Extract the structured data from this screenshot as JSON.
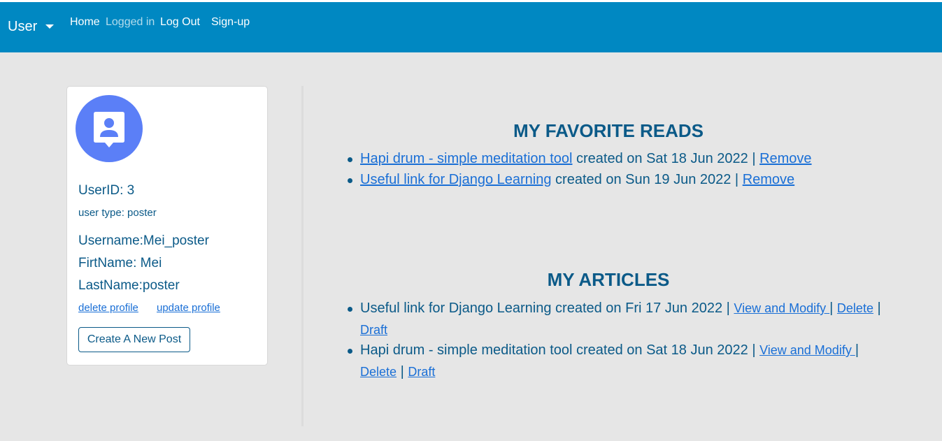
{
  "navbar": {
    "brand": "User",
    "links": {
      "home": "Home",
      "status": "Logged in",
      "logout": "Log Out",
      "signup": "Sign-up"
    }
  },
  "profile": {
    "user_id": "UserID: 3",
    "user_type": "user type: poster",
    "username": "Username:Mei_poster",
    "firstname": "FirtName: Mei",
    "lastname": "LastName:poster",
    "delete_link": "delete profile",
    "update_link": "update profile",
    "new_post_button": "Create A New Post"
  },
  "favorites": {
    "title": "MY FAVORITE READS",
    "items": [
      {
        "title": "Hapi drum - simple meditation tool",
        "meta": " created on Sat 18 Jun 2022 | ",
        "action": "Remove"
      },
      {
        "title": "Useful link for Django Learning",
        "meta": " created on Sun 19 Jun 2022 | ",
        "action": "Remove"
      }
    ]
  },
  "articles": {
    "title": "MY ARTICLES",
    "items": [
      {
        "text": "Useful link for Django Learning created on Fri 17 Jun 2022 | ",
        "view": "View and Modify ",
        "delete": "Delete",
        "draft": "Draft"
      },
      {
        "text": "Hapi drum - simple meditation tool created on Sat 18 Jun 2022 | ",
        "view": "View and Modify ",
        "delete": "Delete",
        "draft": "Draft"
      }
    ]
  },
  "colors": {
    "navbar": "#0088c2",
    "heading": "#0b5a88",
    "link": "#1a6fd6",
    "avatar": "#5b7ff7"
  }
}
